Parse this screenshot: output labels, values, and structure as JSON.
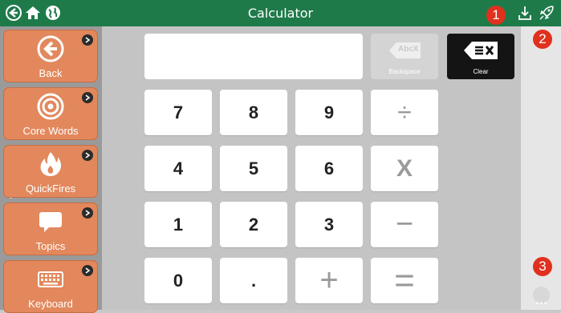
{
  "app": {
    "title": "Calculator"
  },
  "colors": {
    "topbar": "#1f7a4a",
    "sidebar_tile": "#e2885c",
    "badge": "#e0301e",
    "clear_key": "#141414",
    "backspace_key": "#d4d4d4"
  },
  "topbar": {
    "icons": [
      "back-circle-icon",
      "home-icon",
      "globe-icon",
      "download-icon",
      "rocket-icon"
    ]
  },
  "sidebar": {
    "items": [
      {
        "label": "Back",
        "icon": "back-arrow-icon"
      },
      {
        "label": "Core Words",
        "icon": "target-icon"
      },
      {
        "label": "QuickFires",
        "icon": "fire-icon"
      },
      {
        "label": "Topics",
        "icon": "speech-bubble-icon"
      },
      {
        "label": "Keyboard",
        "icon": "keyboard-icon"
      }
    ]
  },
  "calculator": {
    "display_value": "",
    "backspace_label": "Backspace",
    "backspace_glyph_text": "AbcX",
    "clear_label": "Clear",
    "keys": {
      "seven": "7",
      "eight": "8",
      "nine": "9",
      "divide": "÷",
      "four": "4",
      "five": "5",
      "six": "6",
      "multiply": "X",
      "one": "1",
      "two": "2",
      "three": "3",
      "minus": "−",
      "zero": "0",
      "decimal": ".",
      "plus": "+",
      "equals": "="
    }
  },
  "badges": [
    "1",
    "2",
    "3"
  ]
}
